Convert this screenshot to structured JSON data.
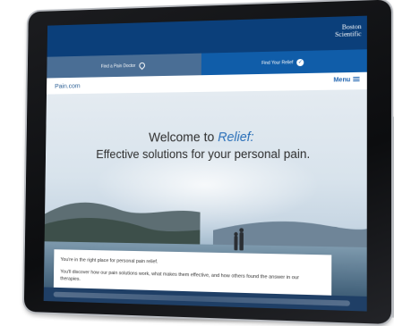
{
  "brand": {
    "logo_line1": "Boston",
    "logo_line2": "Scientific"
  },
  "actions": {
    "find_doctor": "Find a Pain Doctor",
    "find_relief": "Find Your Relief"
  },
  "nav": {
    "site_name": "Pain.com",
    "menu_label": "Menu"
  },
  "hero": {
    "title_prefix": "Welcome to ",
    "title_accent": "Relief:",
    "subtitle": "Effective solutions for your personal pain."
  },
  "info": {
    "line1": "You're in the right place for personal pain relief.",
    "line2": "You'll discover how our pain solutions work, what makes them effective, and how others found the answer in our therapies."
  },
  "colors": {
    "brand_blue": "#0b3f7a",
    "accent_blue": "#2a6fb8"
  }
}
